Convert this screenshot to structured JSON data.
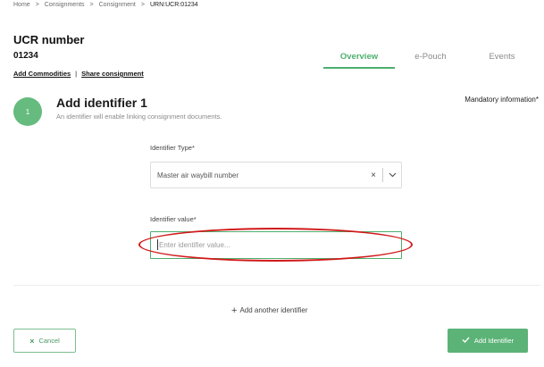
{
  "breadcrumb": {
    "items": [
      "Home",
      "Consignments",
      "Consignment",
      "URN:UCR:01234"
    ],
    "separator": ">"
  },
  "header": {
    "title": "UCR number",
    "number": "01234",
    "links": [
      "Add Commodities",
      "Share consignment"
    ],
    "link_separator": "|"
  },
  "tabs": [
    {
      "label": "Overview",
      "active": true
    },
    {
      "label": "e-Pouch",
      "active": false
    },
    {
      "label": "Events",
      "active": false
    }
  ],
  "step": {
    "number": "1",
    "title": "Add identifier 1",
    "subtitle": "An identifier will enable linking consignment documents.",
    "mandatory_note": "Mandatory information*"
  },
  "form": {
    "identifier_type_label": "Identifier Type*",
    "identifier_type_value": "Master air waybill number",
    "clear_glyph": "×",
    "identifier_value_label": "Identifier value*",
    "identifier_value_placeholder": "Enter identifier value...",
    "identifier_value": ""
  },
  "actions": {
    "add_another_label": "Add another identifier",
    "add_another_glyph": "+",
    "cancel_label": "Cancel",
    "cancel_glyph": "×",
    "submit_label": "Add Identifier"
  },
  "colors": {
    "accent": "#4caf6e",
    "button_green": "#5cb377",
    "highlight": "#d11a1a"
  }
}
